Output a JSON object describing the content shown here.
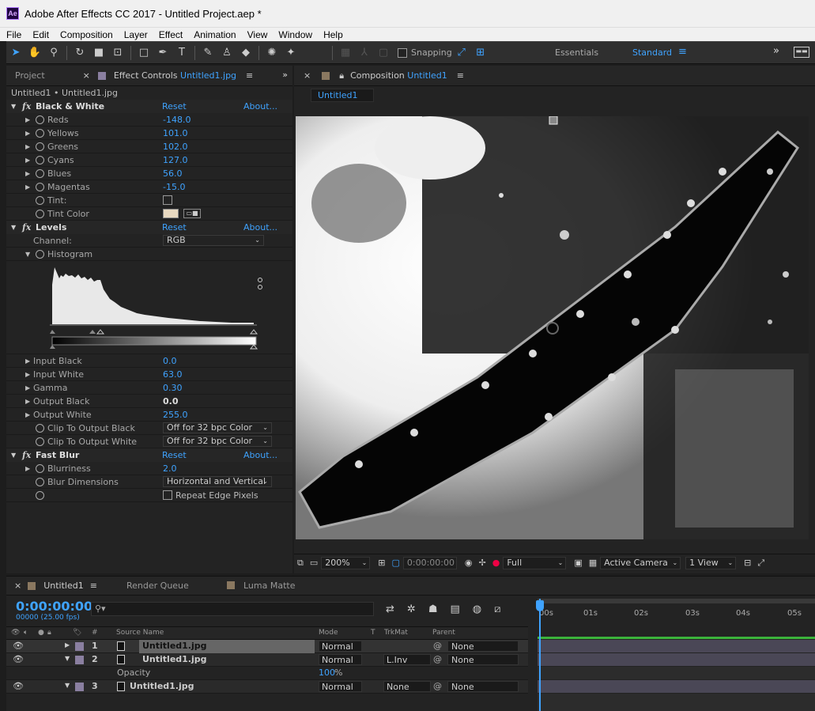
{
  "window": {
    "title": "Adobe After Effects CC 2017 - Untitled Project.aep *",
    "logo": "Ae"
  },
  "menu": [
    "File",
    "Edit",
    "Composition",
    "Layer",
    "Effect",
    "Animation",
    "View",
    "Window",
    "Help"
  ],
  "toolbar": {
    "snapping_label": "Snapping",
    "workspace_essentials": "Essentials",
    "workspace_standard": "Standard"
  },
  "left_panel": {
    "project_tab": "Project",
    "effect_controls_label": "Effect Controls",
    "effect_controls_layer": "Untitled1.jpg",
    "breadcrumb": "Untitled1 • Untitled1.jpg",
    "effects": {
      "bw": {
        "name": "Black & White",
        "reset": "Reset",
        "about": "About...",
        "params": [
          {
            "label": "Reds",
            "value": "-148.0"
          },
          {
            "label": "Yellows",
            "value": "101.0"
          },
          {
            "label": "Greens",
            "value": "102.0"
          },
          {
            "label": "Cyans",
            "value": "127.0"
          },
          {
            "label": "Blues",
            "value": "56.0"
          },
          {
            "label": "Magentas",
            "value": "-15.0"
          }
        ],
        "tint_label": "Tint:",
        "tint_color_label": "Tint Color",
        "tint_color": "#e8d9c0"
      },
      "levels": {
        "name": "Levels",
        "reset": "Reset",
        "about": "About...",
        "channel_label": "Channel:",
        "channel_value": "RGB",
        "histogram_label": "Histogram",
        "params": [
          {
            "label": "Input Black",
            "value": "0.0"
          },
          {
            "label": "Input White",
            "value": "63.0"
          },
          {
            "label": "Gamma",
            "value": "0.30"
          },
          {
            "label": "Output Black",
            "value": "0.0"
          },
          {
            "label": "Output White",
            "value": "255.0"
          }
        ],
        "clip_black_label": "Clip To Output Black",
        "clip_black_value": "Off for 32 bpc Color",
        "clip_white_label": "Clip To Output White",
        "clip_white_value": "Off for 32 bpc Color"
      },
      "blur": {
        "name": "Fast Blur",
        "reset": "Reset",
        "about": "About...",
        "blurriness_label": "Blurriness",
        "blurriness_value": "2.0",
        "dimensions_label": "Blur Dimensions",
        "dimensions_value": "Horizontal and Vertical",
        "repeat_label": "Repeat Edge Pixels"
      }
    }
  },
  "composition": {
    "tab_label": "Composition",
    "tab_comp": "Untitled1",
    "subtab": "Untitled1",
    "zoom": "200%",
    "timecode": "0:00:00:00",
    "resolution": "Full",
    "camera": "Active Camera",
    "views": "1 View"
  },
  "timeline": {
    "comp_tab": "Untitled1",
    "render_queue": "Render Queue",
    "luma_matte": "Luma Matte",
    "timecode": "0:00:00:00",
    "timecode_sub": "00000 (25.00 fps)",
    "search_icon": "⚲▾",
    "headers": {
      "source_name": "Source Name",
      "mode": "Mode",
      "t": "T",
      "trkmat": "TrkMat",
      "parent": "Parent",
      "hash": "#"
    },
    "ruler": [
      "00s",
      "01s",
      "02s",
      "03s",
      "04s",
      "05s"
    ],
    "layers": [
      {
        "num": "1",
        "name": "Untitled1.jpg",
        "mode": "Normal",
        "trkmat": "",
        "parent": "None"
      },
      {
        "num": "2",
        "name": "Untitled1.jpg",
        "mode": "Normal",
        "trkmat": "L.Inv",
        "parent": "None"
      },
      {
        "num": "3",
        "name": "Untitled1.jpg",
        "mode": "Normal",
        "trkmat": "None",
        "parent": "None"
      }
    ],
    "opacity_label": "Opacity",
    "opacity_value": "100",
    "opacity_unit": "%"
  }
}
